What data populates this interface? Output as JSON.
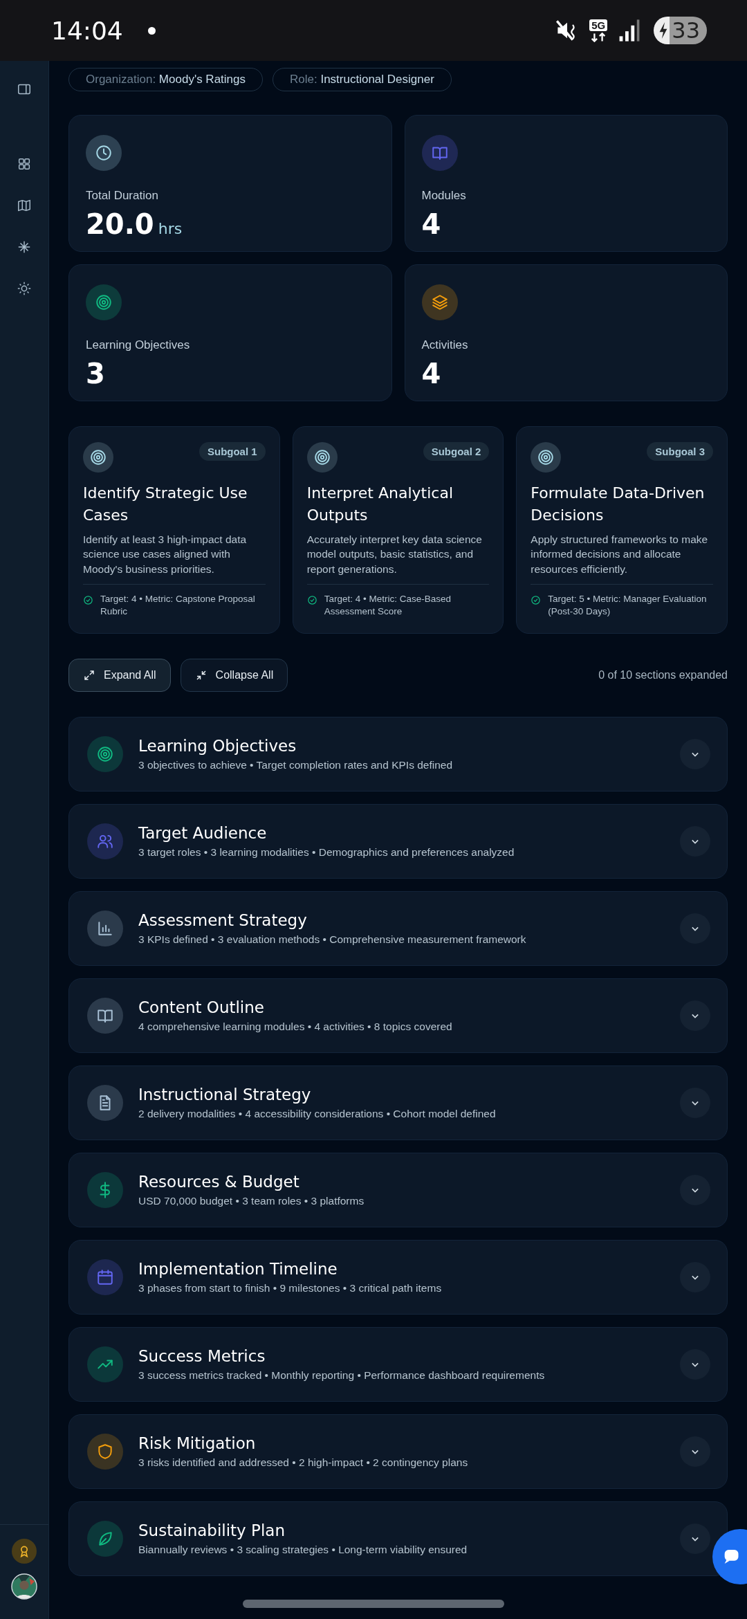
{
  "status_bar": {
    "time": "14:04",
    "network": "5G",
    "battery": "33"
  },
  "chips": [
    {
      "label": "Organization:",
      "value": "Moody's Ratings"
    },
    {
      "label": "Role:",
      "value": "Instructional Designer"
    }
  ],
  "stats": [
    {
      "label": "Total Duration",
      "value": "20.0",
      "unit": "hrs",
      "color": "#a5d8e6"
    },
    {
      "label": "Modules",
      "value": "4",
      "color": "#6366f1"
    },
    {
      "label": "Learning Objectives",
      "value": "3",
      "color": "#10b981"
    },
    {
      "label": "Activities",
      "value": "4",
      "color": "#f59e0b"
    }
  ],
  "subgoals": [
    {
      "badge": "Subgoal 1",
      "title": "Identify Strategic Use Cases",
      "description": "Identify at least 3 high-impact data science use cases aligned with Moody's business priorities.",
      "metric": "Target: 4 • Metric: Capstone Proposal Rubric"
    },
    {
      "badge": "Subgoal 2",
      "title": "Interpret Analytical Outputs",
      "description": "Accurately interpret key data science model outputs, basic statistics, and report generations.",
      "metric": "Target: 4 • Metric: Case-Based Assessment Score"
    },
    {
      "badge": "Subgoal 3",
      "title": "Formulate Data-Driven Decisions",
      "description": "Apply structured frameworks to make informed decisions and allocate resources efficiently.",
      "metric": "Target: 5 • Metric: Manager Evaluation (Post-30 Days)"
    }
  ],
  "controls": {
    "expand_label": "Expand All",
    "collapse_label": "Collapse All",
    "counter": "0 of 10 sections expanded"
  },
  "sections": [
    {
      "title": "Learning Objectives",
      "summary": "3 objectives to achieve • Target completion rates and KPIs defined",
      "color": "#10b981",
      "expanded": false
    },
    {
      "title": "Target Audience",
      "summary": "3 target roles • 3 learning modalities • Demographics and preferences analyzed",
      "color": "#6366f1",
      "expanded": false
    },
    {
      "title": "Assessment Strategy",
      "summary": "3 KPIs defined • 3 evaluation methods • Comprehensive measurement framework",
      "color": "#a9c1d6",
      "expanded": false
    },
    {
      "title": "Content Outline",
      "summary": "4 comprehensive learning modules • 4 activities • 8 topics covered",
      "color": "#a9c1d6",
      "expanded": false
    },
    {
      "title": "Instructional Strategy",
      "summary": "2 delivery modalities • 4 accessibility considerations • Cohort model defined",
      "color": "#a9c1d6",
      "expanded": false
    },
    {
      "title": "Resources & Budget",
      "summary": "USD 70,000 budget • 3 team roles • 3 platforms",
      "color": "#10b981",
      "expanded": false
    },
    {
      "title": "Implementation Timeline",
      "summary": "3 phases from start to finish • 9 milestones • 3 critical path items",
      "color": "#6366f1",
      "expanded": false
    },
    {
      "title": "Success Metrics",
      "summary": "3 success metrics tracked • Monthly reporting • Performance dashboard requirements",
      "color": "#10b981",
      "expanded": false
    },
    {
      "title": "Risk Mitigation",
      "summary": "3 risks identified and addressed • 2 high-impact • 2 contingency plans",
      "color": "#f59e0b",
      "expanded": false
    },
    {
      "title": "Sustainability Plan",
      "summary": "Biannually reviews • 3 scaling strategies • Long-term viability ensured",
      "color": "#10b981",
      "expanded": false
    }
  ]
}
